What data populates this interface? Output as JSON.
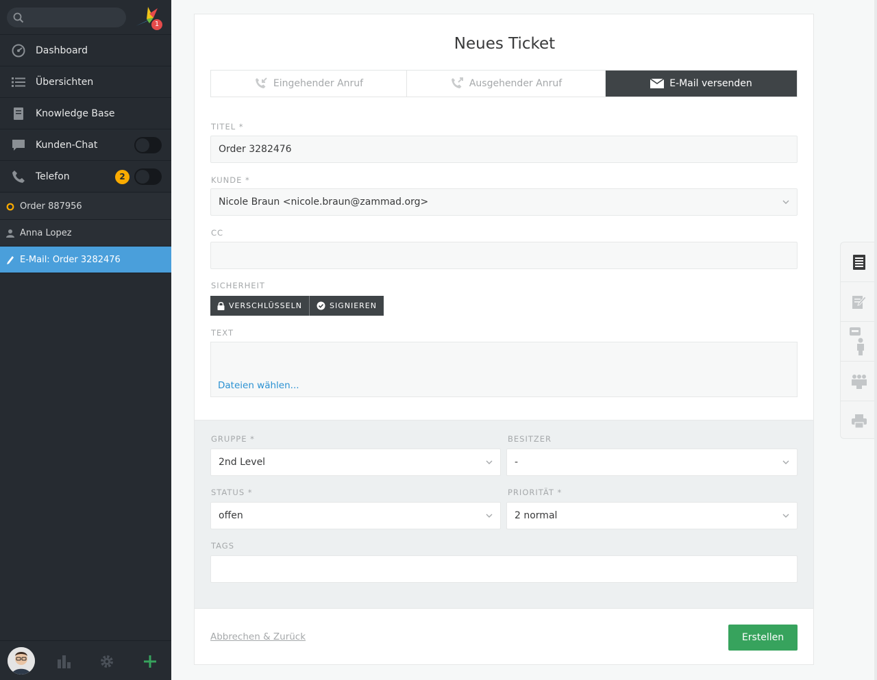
{
  "sidebar": {
    "search_placeholder": "",
    "logo_badge": "1",
    "nav": [
      {
        "label": "Dashboard",
        "icon": "dashboard-icon"
      },
      {
        "label": "Übersichten",
        "icon": "list-icon"
      },
      {
        "label": "Knowledge Base",
        "icon": "book-icon"
      },
      {
        "label": "Kunden-Chat",
        "icon": "chat-icon"
      },
      {
        "label": "Telefon",
        "icon": "phone-icon",
        "badge": "2"
      }
    ],
    "tasks": [
      {
        "label": "Order 887956",
        "icon": "ticket-open-icon"
      },
      {
        "label": "Anna Lopez",
        "icon": "user-icon"
      },
      {
        "label": "E-Mail: Order 3282476",
        "icon": "pencil-icon"
      }
    ]
  },
  "ticket": {
    "title": "Neues Ticket",
    "tabs": [
      "Eingehender Anruf",
      "Ausgehender Anruf",
      "E-Mail versenden"
    ],
    "labels": {
      "titel": "TITEL *",
      "kunde": "KUNDE *",
      "cc": "CC",
      "sicherheit": "SICHERHEIT",
      "text": "TEXT",
      "gruppe": "GRUPPE *",
      "besitzer": "BESITZER",
      "status": "STATUS *",
      "prioritaet": "PRIORITÄT *",
      "tags": "TAGS"
    },
    "values": {
      "titel": "Order 3282476",
      "kunde": "Nicole Braun <nicole.braun@zammad.org>",
      "cc": "",
      "gruppe": "2nd Level",
      "besitzer": "-",
      "status": "offen",
      "prioritaet": "2 normal",
      "tags": ""
    },
    "security_buttons": [
      "VERSCHLÜSSELN",
      "SIGNIEREN"
    ],
    "file_link": "Dateien wählen...",
    "cancel": "Abbrechen & Zurück",
    "submit": "Erstellen"
  },
  "colors": {
    "sidebar": "#262b31",
    "active_task": "#4a9fdb",
    "submit": "#37a35d",
    "badge": "#faab00"
  }
}
